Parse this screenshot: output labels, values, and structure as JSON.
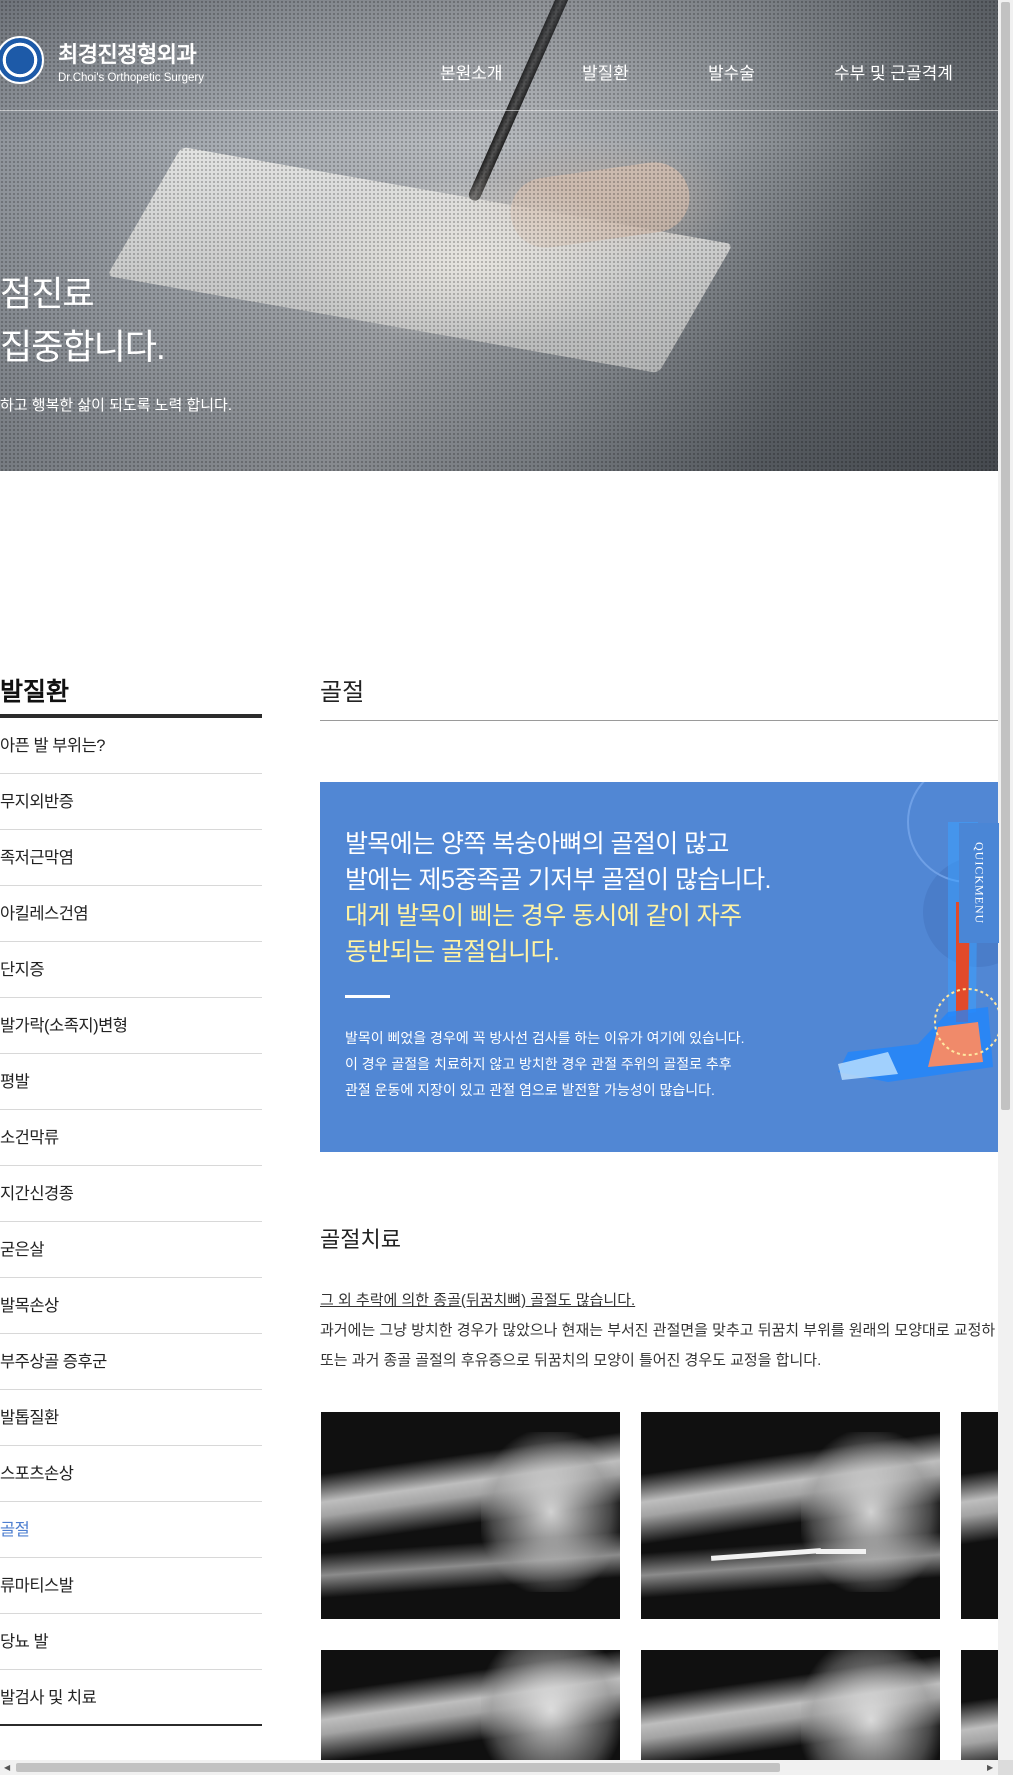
{
  "header": {
    "logo_kr": "최경진정형외과",
    "logo_en": "Dr.Choi's Orthopetic Surgery",
    "nav": [
      "본원소개",
      "발질환",
      "발수술",
      "수부 및 근골격계"
    ]
  },
  "hero": {
    "title": "점진료\n집중합니다.",
    "subtitle": "하고 행복한 삶이 되도록 노력 합니다."
  },
  "sidebar": {
    "title": "발질환",
    "items": [
      "아픈 발 부위는?",
      "무지외반증",
      "족저근막염",
      "아킬레스건염",
      "단지증",
      "발가락(소족지)변형",
      "평발",
      "소건막류",
      "지간신경종",
      "굳은살",
      "발목손상",
      "부주상골 증후군",
      "발톱질환",
      "스포츠손상",
      "골절",
      "류마티스발",
      "당뇨 발",
      "발검사 및 치료"
    ],
    "active_index": 14
  },
  "main": {
    "title": "골절",
    "banner": {
      "head_white": [
        "발목에는 양쪽 복숭아뼈의 골절이 많고",
        "발에는 제5중족골 기저부 골절이 많습니다."
      ],
      "head_yellow": [
        "대게 발목이 삐는 경우 동시에 같이 자주",
        "동반되는 골절입니다."
      ],
      "body": [
        "발목이 삐었을 경우에 꼭 방사선 검사를 하는 이유가 여기에 있습니다.",
        "이 경우 골절을 치료하지 않고 방치한 경우 관절 주위의 골절로 추후",
        "관절 운동에 지장이 있고 관절 염으로 발전할 가능성이 많습니다."
      ]
    },
    "sub_title": "골절치료",
    "desc": {
      "underlined": "그 외 추락에 의한 종골(뒤꿈치뼈) 골절도 많습니다.",
      "line1": "과거에는 그냥 방치한 경우가 많았으나 현재는 부서진 관절면을 맞추고 뒤꿈치 부위를 원래의 모양대로 교정하",
      "line2": "또는 과거 종골 골절의 후유증으로 뒤꿈치의 모양이 틀어진 경우도 교정을 합니다."
    }
  },
  "quickmenu": "QUICKMENU",
  "colors": {
    "banner_bg": "#5187d4",
    "banner_highlight": "#fff3a3",
    "active_link": "#4e7fd0"
  }
}
